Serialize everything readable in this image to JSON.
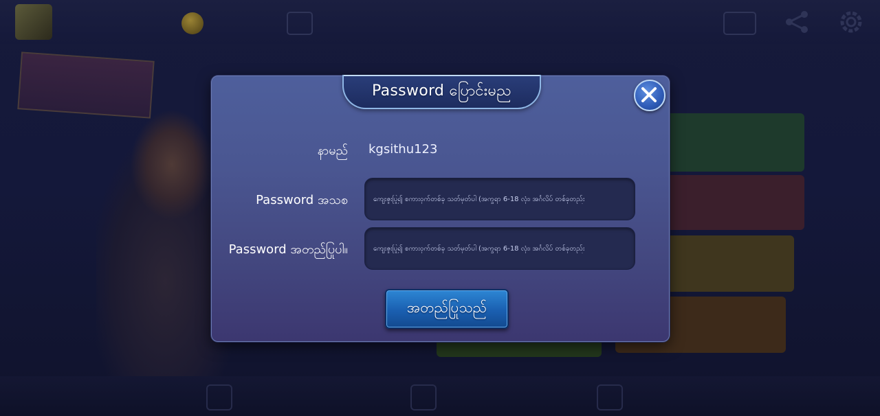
{
  "dialog": {
    "title": "Password ပြောင်းမည",
    "username_label": "နာမည်",
    "username_value": "kgsithu123",
    "new_password_label": "Password အသစ",
    "new_password_placeholder": "ကျေးဇူးပြု၍ စကားဝှက်တစ်ခု သတ်မှတ်ပါ (အက္ခရာ 6-18 လုံး၊ အင်္ဂလိပ် တစ်ခုတည်း",
    "confirm_password_label": "Password အတည်ပြုပါ။",
    "confirm_password_placeholder": "ကျေးဇူးပြု၍ စကားဝှက်တစ်ခု သတ်မှတ်ပါ (အက္ခရာ 6-18 လုံး၊ အင်္ဂလိပ် တစ်ခုတည်း",
    "confirm_button": "အတည်ပြုသည်"
  },
  "icons": {
    "close": "close-icon",
    "share": "share-icon",
    "settings": "gear-icon"
  },
  "colors": {
    "dialog_top": "#4e5f9c",
    "dialog_bottom": "#3c3770",
    "confirm_button": "#1a5fb0",
    "input_background": "#242a50"
  }
}
